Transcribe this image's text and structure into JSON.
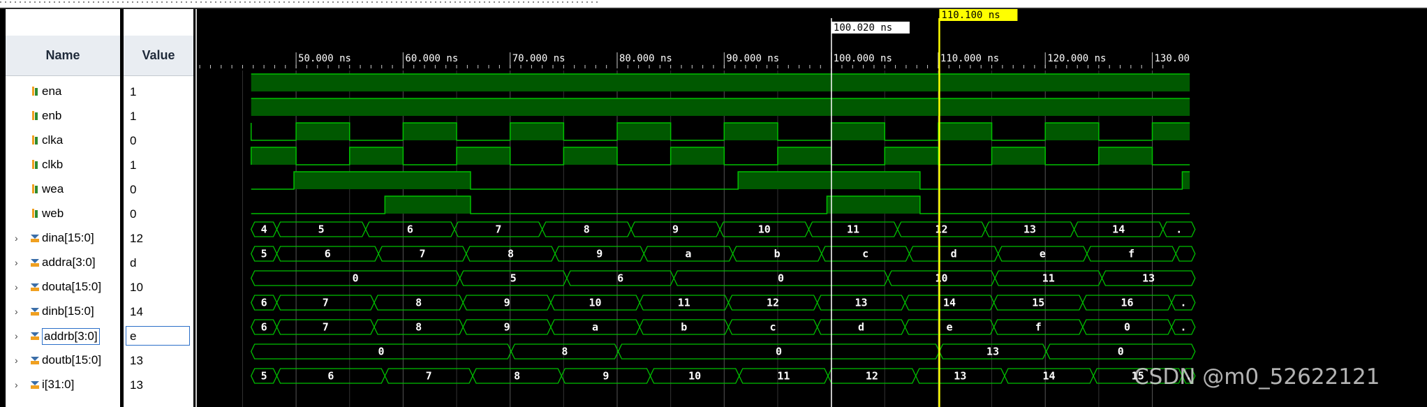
{
  "columns": {
    "name": "Name",
    "value": "Value"
  },
  "timescale": {
    "ticks": [
      "50.000 ns",
      "60.000 ns",
      "70.000 ns",
      "80.000 ns",
      "90.000 ns",
      "100.000 ns",
      "110.000 ns",
      "120.000 ns",
      "130.00"
    ],
    "tick_times": [
      50,
      60,
      70,
      80,
      90,
      100,
      110,
      120,
      130
    ]
  },
  "markers": [
    {
      "label": "100.020 ns",
      "time": 100.02,
      "color": "#ffffff"
    },
    {
      "label": "110.100 ns",
      "time": 110.1,
      "color": "#ffff00"
    }
  ],
  "signals": [
    {
      "name": "ena",
      "value": "1",
      "kind": "bit",
      "expandable": false
    },
    {
      "name": "enb",
      "value": "1",
      "kind": "bit",
      "expandable": false
    },
    {
      "name": "clka",
      "value": "0",
      "kind": "bit",
      "expandable": false
    },
    {
      "name": "clkb",
      "value": "1",
      "kind": "bit",
      "expandable": false
    },
    {
      "name": "wea",
      "value": "0",
      "kind": "bit",
      "expandable": false
    },
    {
      "name": "web",
      "value": "0",
      "kind": "bit",
      "expandable": false
    },
    {
      "name": "dina[15:0]",
      "value": "12",
      "kind": "bus",
      "expandable": true
    },
    {
      "name": "addra[3:0]",
      "value": "d",
      "kind": "bus",
      "expandable": true
    },
    {
      "name": "douta[15:0]",
      "value": "10",
      "kind": "bus",
      "expandable": true
    },
    {
      "name": "dinb[15:0]",
      "value": "14",
      "kind": "bus",
      "expandable": true
    },
    {
      "name": "addrb[3:0]",
      "value": "e",
      "kind": "bus",
      "expandable": true,
      "selected": true
    },
    {
      "name": "doutb[15:0]",
      "value": "13",
      "kind": "bus",
      "expandable": true
    },
    {
      "name": "i[31:0]",
      "value": "13",
      "kind": "bus",
      "expandable": true
    }
  ],
  "waves": {
    "ena": {
      "edges": [],
      "init": 1
    },
    "enb": {
      "edges": [],
      "init": 1
    },
    "clka": {
      "init": 1,
      "edges": [
        45.8,
        50,
        55,
        60,
        65,
        70,
        75,
        80,
        85,
        90,
        95,
        100,
        105,
        110,
        115,
        120,
        125,
        130
      ]
    },
    "clkb": {
      "init": 0,
      "edges": [
        45.8,
        50,
        55,
        60,
        65,
        70,
        75,
        80,
        85,
        90,
        95,
        100,
        105,
        110,
        115,
        120,
        125,
        130
      ]
    },
    "wea": {
      "init": 0,
      "edges": [
        49.8,
        66.3,
        91.3,
        108.3,
        132.8
      ]
    },
    "web": {
      "init": 0,
      "edges": [
        58.3,
        66.3,
        99.6,
        108.3
      ]
    },
    "dina[15:0]": {
      "segments": [
        [
          45.8,
          "4"
        ],
        [
          48.2,
          "5"
        ],
        [
          56.5,
          "6"
        ],
        [
          64.8,
          "7"
        ],
        [
          73.0,
          "8"
        ],
        [
          81.3,
          "9"
        ],
        [
          89.6,
          "10"
        ],
        [
          97.9,
          "11"
        ],
        [
          106.2,
          "12"
        ],
        [
          114.4,
          "13"
        ],
        [
          122.7,
          "14"
        ],
        [
          131.0,
          "."
        ]
      ]
    },
    "addra[3:0]": {
      "segments": [
        [
          45.8,
          "5"
        ],
        [
          48.2,
          "6"
        ],
        [
          57.7,
          "7"
        ],
        [
          65.9,
          "8"
        ],
        [
          74.2,
          "9"
        ],
        [
          82.5,
          "a"
        ],
        [
          90.8,
          "b"
        ],
        [
          99.1,
          "c"
        ],
        [
          107.3,
          "d"
        ],
        [
          115.6,
          "e"
        ],
        [
          123.9,
          "f"
        ],
        [
          132.2,
          ""
        ]
      ]
    },
    "douta[15:0]": {
      "segments": [
        [
          45.8,
          "0"
        ],
        [
          65.3,
          "5"
        ],
        [
          75.3,
          "6"
        ],
        [
          85.3,
          "0"
        ],
        [
          105.3,
          "10"
        ],
        [
          115.3,
          "11"
        ],
        [
          125.3,
          "13"
        ]
      ]
    },
    "dinb[15:0]": {
      "segments": [
        [
          45.8,
          "6"
        ],
        [
          48.2,
          "7"
        ],
        [
          57.3,
          "8"
        ],
        [
          65.6,
          "9"
        ],
        [
          73.8,
          "10"
        ],
        [
          82.1,
          "11"
        ],
        [
          90.4,
          "12"
        ],
        [
          98.7,
          "13"
        ],
        [
          106.9,
          "14"
        ],
        [
          115.2,
          "15"
        ],
        [
          123.5,
          "16"
        ],
        [
          131.8,
          "."
        ]
      ]
    },
    "addrb[3:0]": {
      "segments": [
        [
          45.8,
          "6"
        ],
        [
          48.2,
          "7"
        ],
        [
          57.3,
          "8"
        ],
        [
          65.6,
          "9"
        ],
        [
          73.8,
          "a"
        ],
        [
          82.1,
          "b"
        ],
        [
          90.4,
          "c"
        ],
        [
          98.7,
          "d"
        ],
        [
          106.9,
          "e"
        ],
        [
          115.2,
          "f"
        ],
        [
          123.5,
          "0"
        ],
        [
          131.8,
          "."
        ]
      ]
    },
    "doutb[15:0]": {
      "segments": [
        [
          45.8,
          "0"
        ],
        [
          70.1,
          "8"
        ],
        [
          80.1,
          "0"
        ],
        [
          110.1,
          "13"
        ],
        [
          120.1,
          "0"
        ]
      ]
    },
    "i[31:0]": {
      "segments": [
        [
          45.8,
          "5"
        ],
        [
          48.2,
          "6"
        ],
        [
          58.3,
          "7"
        ],
        [
          66.5,
          "8"
        ],
        [
          74.8,
          "9"
        ],
        [
          83.1,
          "10"
        ],
        [
          91.4,
          "11"
        ],
        [
          99.7,
          "12"
        ],
        [
          107.9,
          "13"
        ],
        [
          116.2,
          "14"
        ],
        [
          124.5,
          "15"
        ],
        [
          132.8,
          "."
        ]
      ]
    }
  },
  "watermark": "CSDN @m0_52622121",
  "colors": {
    "wave": "#00c000",
    "fill": "#005800",
    "background": "#000000",
    "grid": "#555555",
    "cursor": "#ffff00",
    "marker": "#ffffff"
  }
}
